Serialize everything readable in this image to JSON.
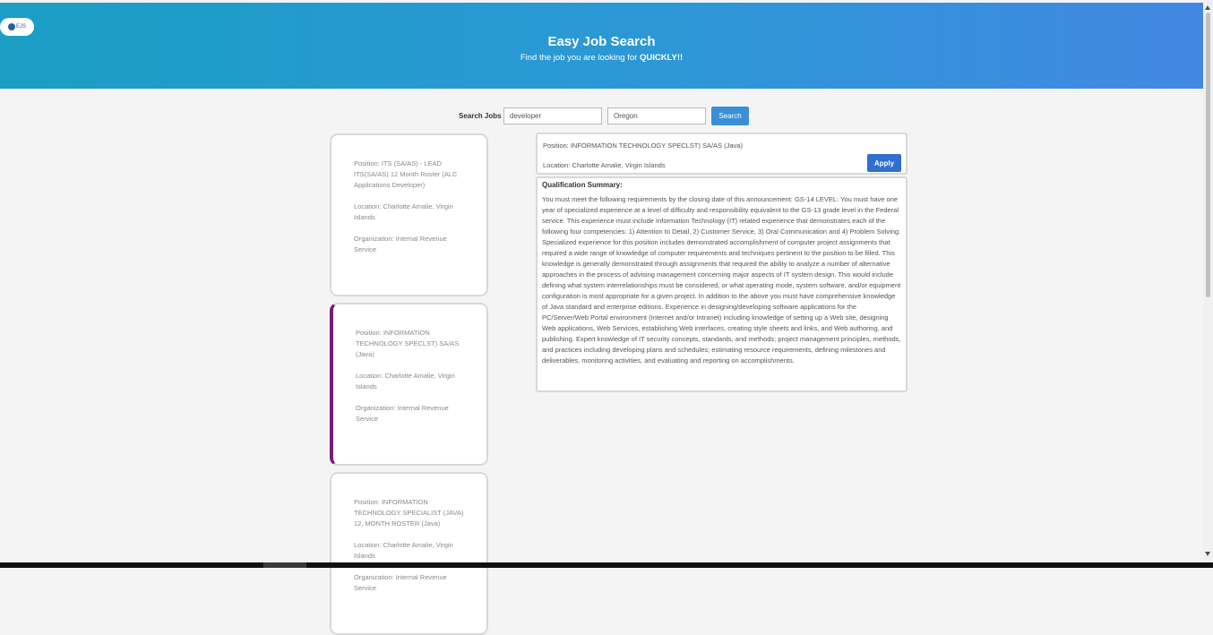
{
  "header": {
    "logo_text": "EJS",
    "title": "Easy Job Search",
    "subtitle_prefix": "Find the job you are looking for ",
    "subtitle_emphasis": "QUICKLY!!",
    "gradient_colors": [
      "#1a9ec4",
      "#4287e2"
    ]
  },
  "search": {
    "label": "Search Jobs",
    "query_value": "developer",
    "location_value": "Oregon",
    "button_label": "Search",
    "button_color": "#3a8fd6"
  },
  "jobs": [
    {
      "position": "Position: ITS (SA/AS) - LEAD ITS(SA/AS) 12 Month Roster (ALC Applications Developer)",
      "location": "Location: Charlotte Amalie, Virgin Islands",
      "organization": "Organization: Internal Revenue Service"
    },
    {
      "position": "Position: INFORMATION TECHNOLOGY SPECLST) SA/AS (Java)",
      "location": "Location: Charlotte Amalie, Virgin Islands",
      "organization": "Organization: Internal Revenue Service"
    },
    {
      "position": "Position: INFORMATION TECHNOLOGY SPECIALIST (JAVA) 12, MONTH ROSTER (Java)",
      "location": "Location: Charlotte Amalie, Virgin Islands",
      "organization": "Organization: Internal Revenue Service"
    }
  ],
  "active_accent_color": "#7b1a7a",
  "detail": {
    "position": "Position: INFORMATION TECHNOLOGY SPECLST) SA/AS (Java)",
    "location": "Location: Charlotte Amalie, Virgin Islands",
    "apply_label": "Apply",
    "apply_color": "#2f6fcf",
    "summary_title": "Qualification Summary:",
    "summary_text": "You must meet the following requirements by the closing date of this announcement: GS-14 LEVEL: You must have one year of specialized experience at a level of difficulty and responsibility equivalent to the GS-13 grade level in the Federal service. This experience must include Information Technology (IT) related experience that demonstrates each of the following four competencies: 1) Attention to Detail, 2) Customer Service, 3) Oral Communication and 4) Problem Solving. Specialized experience for this position includes demonstrated accomplishment of computer project assignments that required a wide range of knowledge of computer requirements and techniques pertinent to the position to be filled. This knowledge is generally demonstrated through assignments that required the ability to analyze a number of alternative approaches in the process of advising management concerning major aspects of IT system design. This would include defining what system interrelationships must be considered, or what operating mode, system software, and/or equipment configuration is most appropriate for a given project. In addition to the above you must have comprehensive knowledge of Java standard and enterprise editions. Experience in designing/developing software applications for the PC/Server/Web Portal environment (Internet and/or Intranet) including knowledge of setting up a Web site, designing Web applications, Web Services, establishing Web interfaces, creating style sheets and links, and Web authoring, and publishing. Expert knowledge of IT security concepts, standards, and methods; project management principles, methods, and practices including developing plans and schedules; estimating resource requirements, defining milestones and deliverables, monitoring activities, and evaluating and reporting on accomplishments."
  }
}
